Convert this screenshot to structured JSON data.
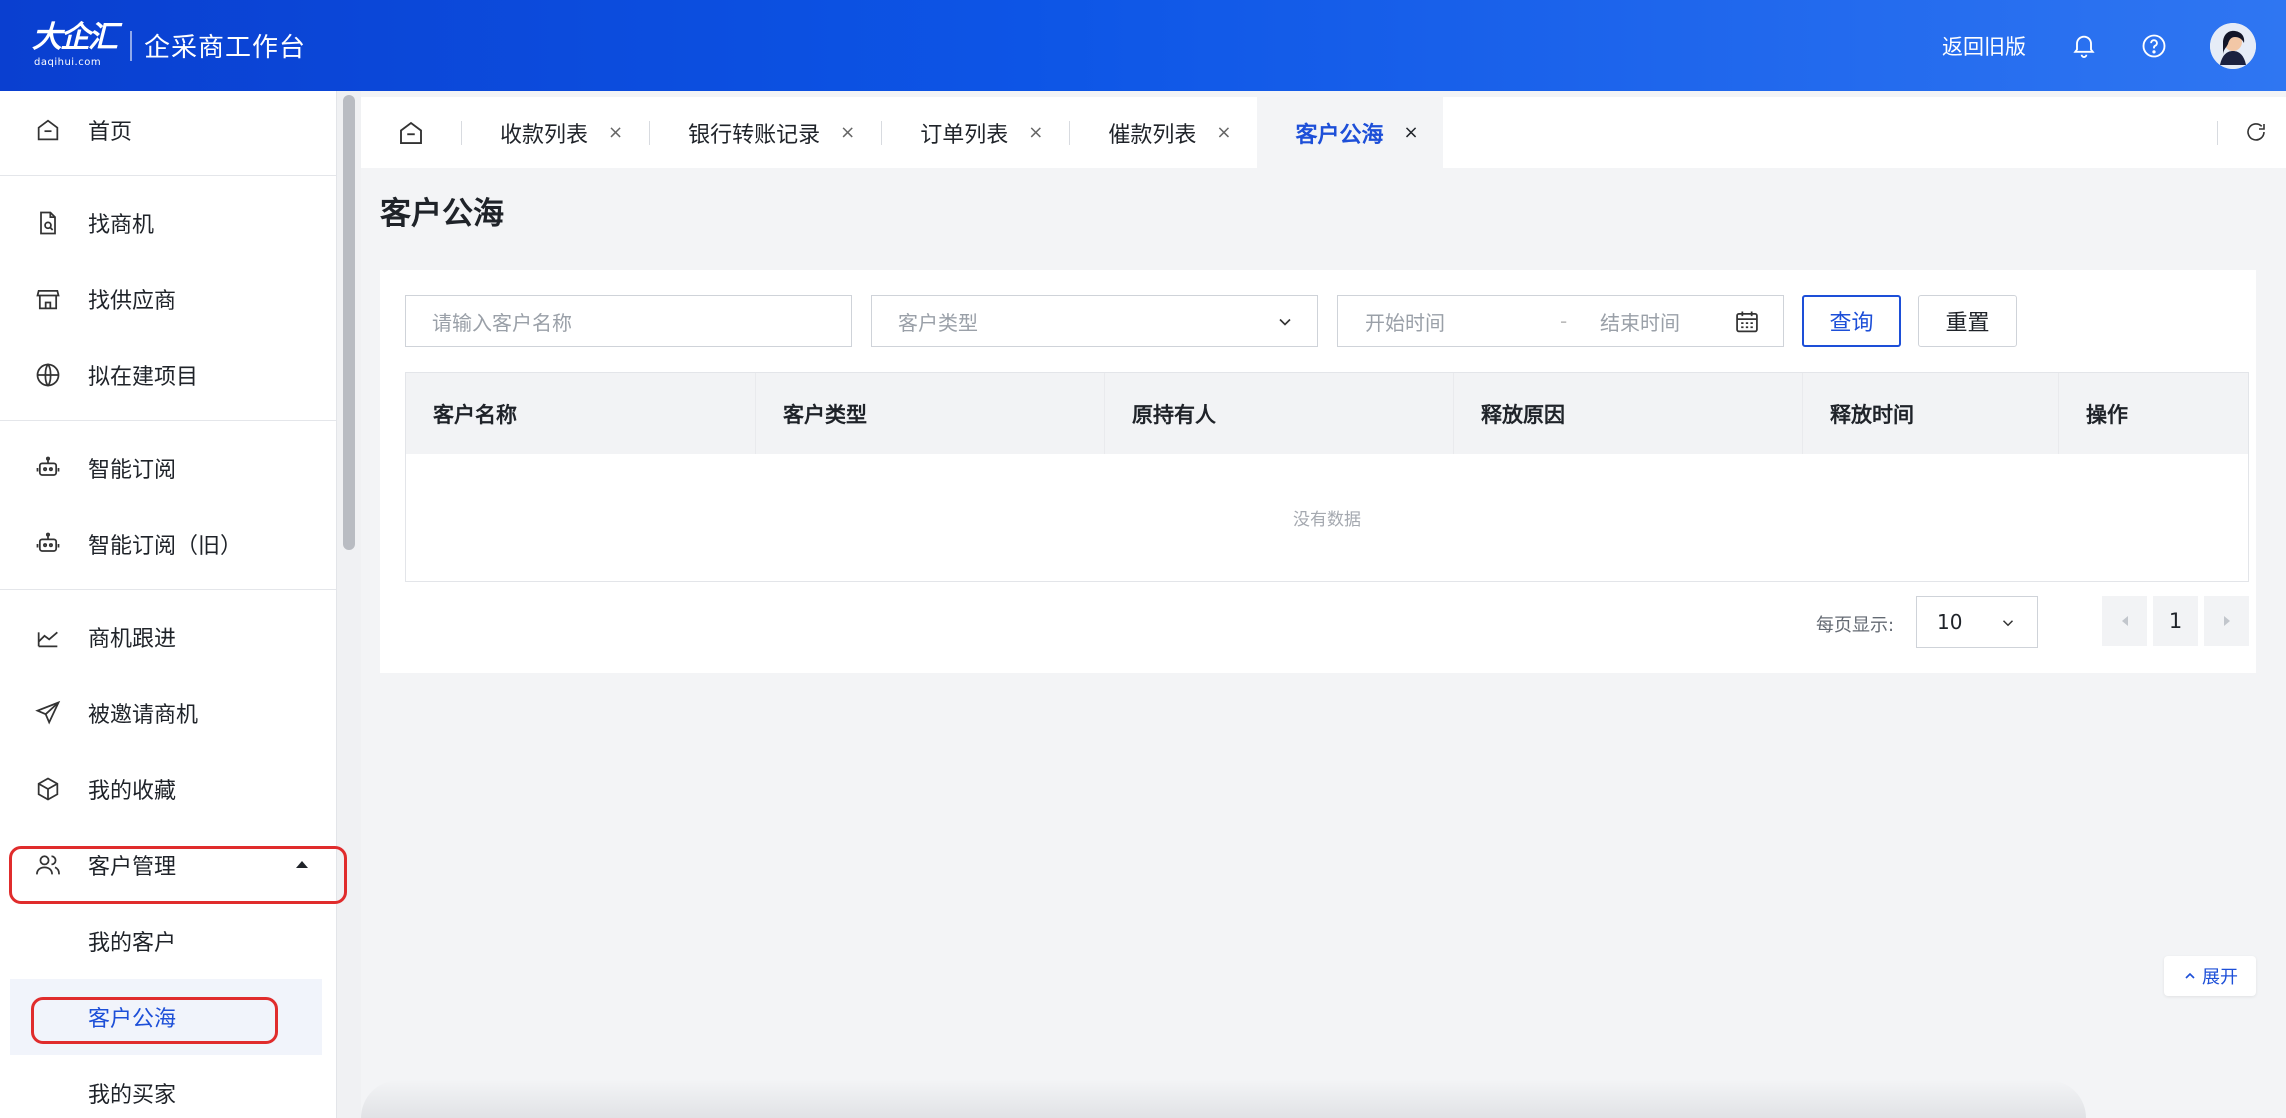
{
  "header": {
    "logo_text": "大企汇",
    "logo_sub": "daqihui.com",
    "app_title": "企采商工作台",
    "back_old": "返回旧版",
    "icons": [
      "bell-icon",
      "help-icon",
      "avatar"
    ]
  },
  "sidebar": {
    "items": [
      {
        "label": "首页",
        "icon": "home-icon"
      },
      {
        "label": "找商机",
        "icon": "doc-search-icon"
      },
      {
        "label": "找供应商",
        "icon": "store-icon"
      },
      {
        "label": "拟在建项目",
        "icon": "globe-icon"
      },
      {
        "label": "智能订阅",
        "icon": "robot-icon"
      },
      {
        "label": "智能订阅（旧）",
        "icon": "robot-icon"
      },
      {
        "label": "商机跟进",
        "icon": "chart-icon"
      },
      {
        "label": "被邀请商机",
        "icon": "send-icon"
      },
      {
        "label": "我的收藏",
        "icon": "cube-icon"
      },
      {
        "label": "客户管理",
        "icon": "users-icon",
        "expanded": true
      },
      {
        "label": "我的客户"
      },
      {
        "label": "客户公海",
        "active": true
      },
      {
        "label": "我的买家"
      }
    ]
  },
  "tabs": {
    "items": [
      {
        "label": "收款列表",
        "close": "×"
      },
      {
        "label": "银行转账记录",
        "close": "×"
      },
      {
        "label": "订单列表",
        "close": "×"
      },
      {
        "label": "催款列表",
        "close": "×"
      },
      {
        "label": "客户公海",
        "close": "×",
        "active": true
      }
    ]
  },
  "page": {
    "title": "客户公海"
  },
  "filters": {
    "name_placeholder": "请输入客户名称",
    "type_placeholder": "客户类型",
    "start_placeholder": "开始时间",
    "date_sep": "-",
    "end_placeholder": "结束时间",
    "query": "查询",
    "reset": "重置"
  },
  "table": {
    "columns": [
      "客户名称",
      "客户类型",
      "原持有人",
      "释放原因",
      "释放时间",
      "操作"
    ],
    "rows": [],
    "empty_text": "没有数据"
  },
  "pagination": {
    "page_size_label": "每页显示:",
    "page_size": "10",
    "current_page": "1"
  },
  "expand": {
    "label": "展开"
  },
  "colors": {
    "primary": "#1d4fd8",
    "header_gradient_start": "#0a3fd0",
    "header_gradient_end": "#2f76f2",
    "highlight_red": "#e02c2c"
  }
}
